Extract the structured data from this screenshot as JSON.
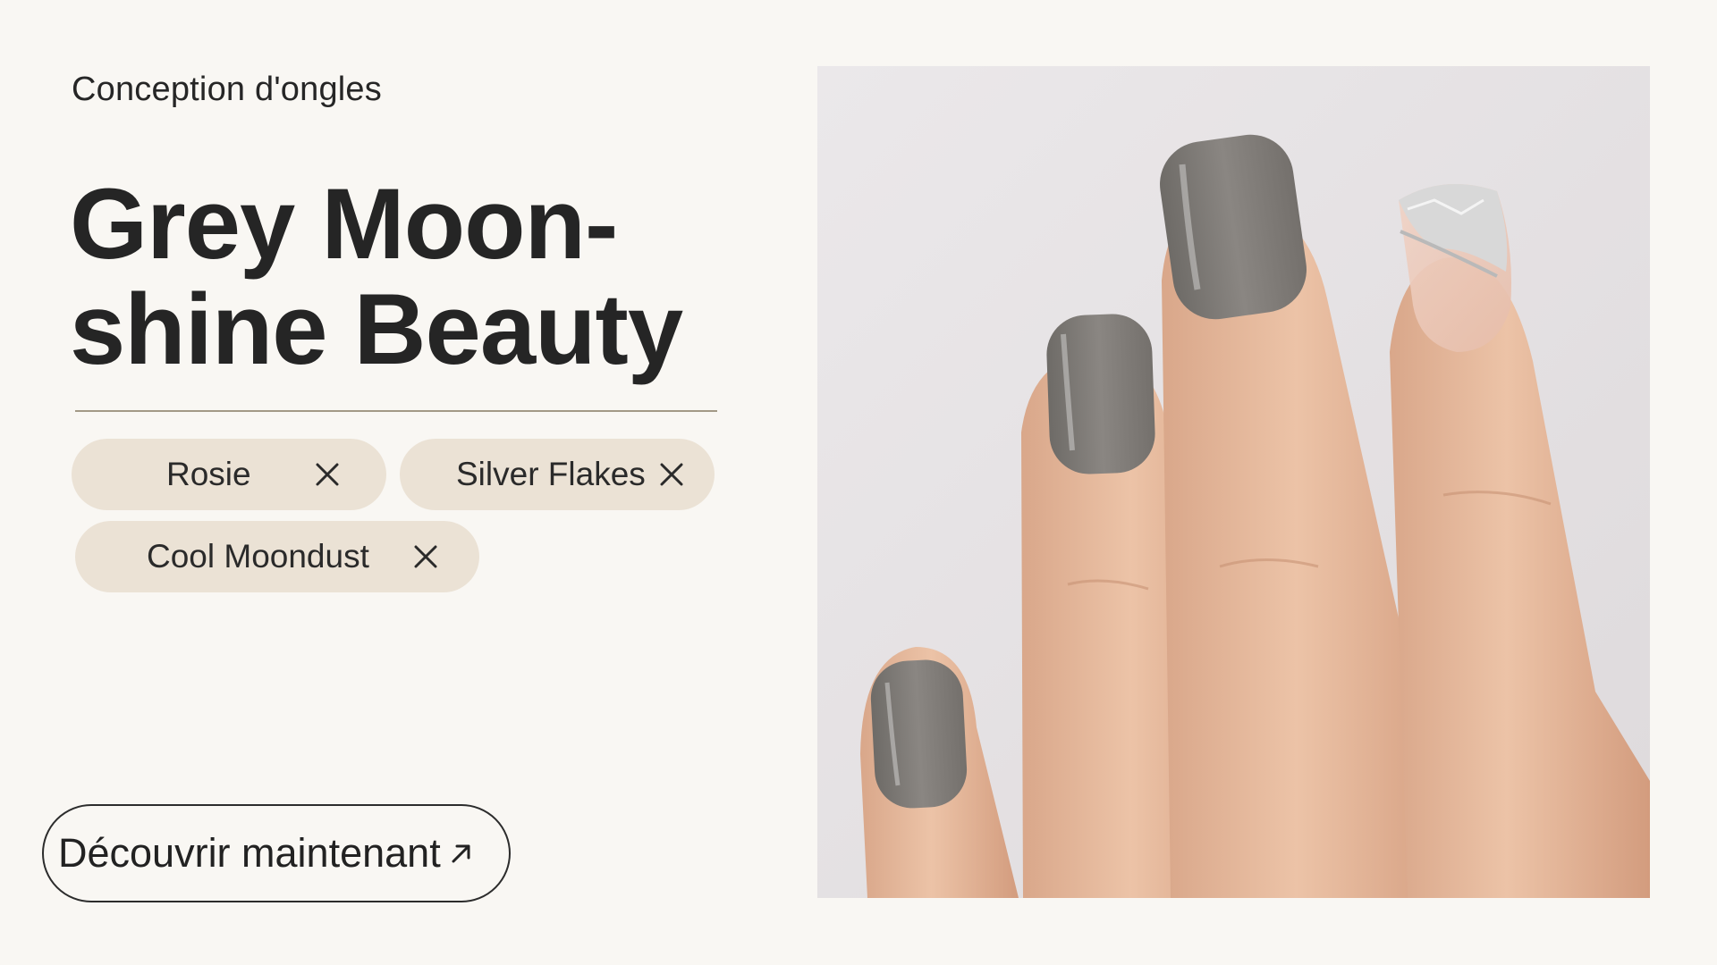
{
  "header": {
    "eyebrow": "Conception d'ongles"
  },
  "hero": {
    "title_line_1": "Grey Moon-",
    "title_line_2": "shine Beauty"
  },
  "chips": [
    {
      "label": "Rosie",
      "remove_icon": "close-icon"
    },
    {
      "label": "Silver Flakes",
      "remove_icon": "close-icon"
    },
    {
      "label": "Cool Moondust",
      "remove_icon": "close-icon"
    }
  ],
  "cta": {
    "label": "Découvrir maintenant",
    "icon": "arrow-up-right-icon"
  },
  "photo": {
    "subject": "hand-with-grey-nail-polish-photo"
  },
  "colors": {
    "background": "#f9f7f3",
    "chip_fill": "#ebe2d5",
    "text": "#242424",
    "divider": "#a39986",
    "nail_grey": "#7f7c78",
    "skin": "#e7b99c"
  }
}
